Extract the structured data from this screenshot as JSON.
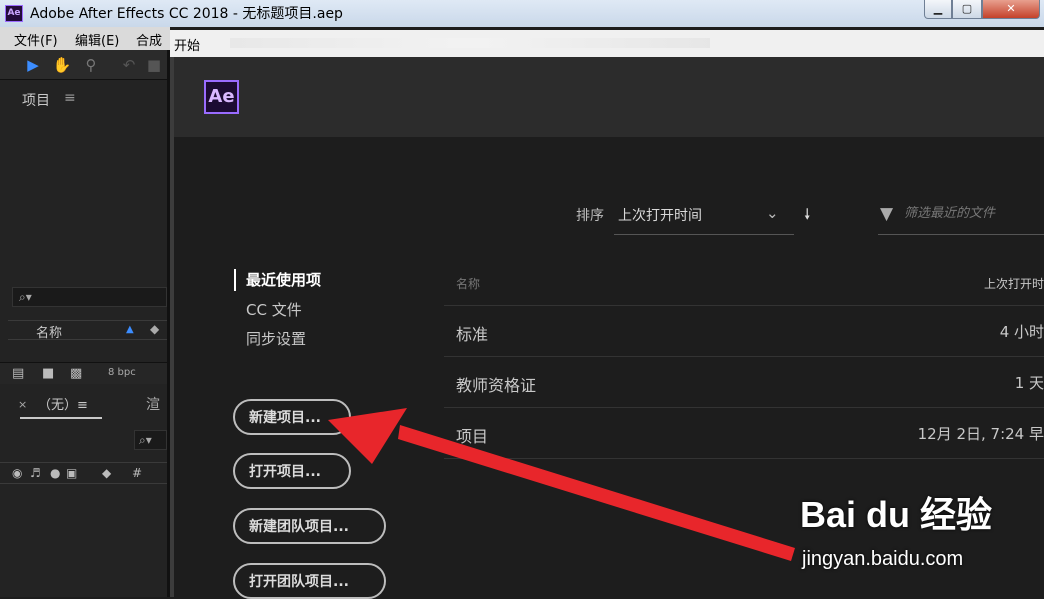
{
  "window": {
    "app_icon": "Ae",
    "title": "Adobe After Effects CC 2018 - 无标题项目.aep",
    "min_icon": "▁",
    "max_icon": "▢",
    "close_icon": "✕"
  },
  "menubar": {
    "items": [
      "文件(F)",
      "编辑(E)",
      "合成"
    ]
  },
  "project_panel": {
    "title": "项目",
    "menu_glyph": "≡",
    "search_glyph": "⌕▾",
    "col_name": "名称",
    "bpc": "8 bpc"
  },
  "comp_panel": {
    "close_glyph": "×",
    "tab_label": "（无）≡",
    "render_label": "渲",
    "search_glyph": "⌕▾",
    "layer_hash": "#"
  },
  "start_tab": {
    "label": "开始"
  },
  "dialog": {
    "logo": "Ae",
    "sort_label": "排序",
    "sort_value": "上次打开时间",
    "filter_placeholder": "筛选最近的文件",
    "nav": [
      "最近使用项",
      "CC 文件",
      "同步设置"
    ],
    "buttons": {
      "new_project": "新建项目...",
      "open_project": "打开项目...",
      "new_team": "新建团队项目...",
      "open_team": "打开团队项目..."
    },
    "table": {
      "col_name": "名称",
      "col_time": "上次打开时",
      "rows": [
        {
          "name": "标准",
          "time": "4 小时"
        },
        {
          "name": "教师资格证",
          "time": "1 天"
        },
        {
          "name": "项目",
          "time": "12月 2日, 7:24 早"
        }
      ]
    }
  },
  "colors": {
    "annotation_arrow": "#e8262b",
    "ae_purple": "#9a6cff",
    "select_blue": "#3c8dff"
  },
  "watermark": {
    "logo": "Bai du 经验",
    "url": "jingyan.baidu.com"
  }
}
